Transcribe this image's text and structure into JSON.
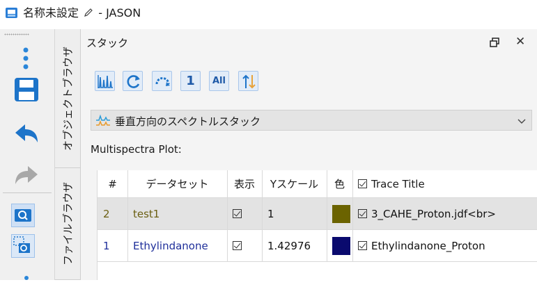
{
  "window": {
    "title": "名称未設定",
    "title_suffix": " - JASON"
  },
  "toolbar": {
    "icons": [
      "more-vertical-icon",
      "save-icon",
      "undo-icon",
      "redo-icon",
      "zoom-icon",
      "zoom-region-icon"
    ]
  },
  "side_tabs": {
    "object_browser": "オブジェクトブラウザ",
    "file_browser": "ファイルブラウザ"
  },
  "panel": {
    "title": "スタック",
    "buttons": {
      "one_label": "1",
      "all_label": "All"
    },
    "stack_mode": {
      "selected": "垂直方向のスペクトルスタック"
    },
    "plot_label": "Multispectra Plot:"
  },
  "table": {
    "headers": {
      "index": "#",
      "dataset": "データセット",
      "show": "表示",
      "yscale": "Yスケール",
      "color": "色",
      "trace_title": "Trace Title"
    },
    "rows": [
      {
        "index": "2",
        "dataset": "test1",
        "yscale": "1",
        "color": "#6b6300",
        "trace_title": "3_CAHE_Proton.jdf<br>"
      },
      {
        "index": "1",
        "dataset": "Ethylindanone",
        "yscale": "1.42976",
        "color": "#0a0a6e",
        "trace_title": "Ethylindanone_Proton"
      }
    ]
  },
  "colors": {
    "accent": "#1f73c8",
    "selected_row": "#e3e3e3",
    "row1_text": "#6b5f12",
    "row2_text": "#1f2f9a"
  }
}
